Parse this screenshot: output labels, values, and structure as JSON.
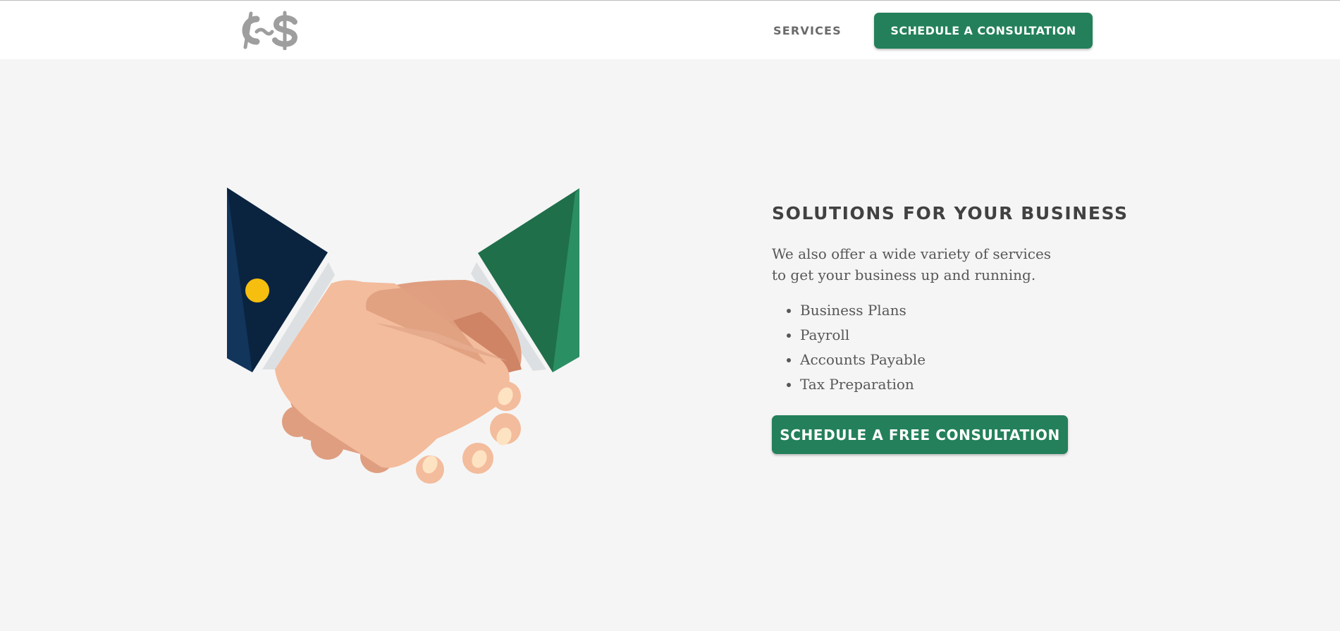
{
  "header": {
    "logo_text": "C$",
    "nav_services": "SERVICES",
    "nav_cta": "SCHEDULE A CONSULTATION"
  },
  "hero": {
    "illustration": "handshake-illustration",
    "heading": "SOLUTIONS FOR YOUR BUSINESS",
    "description": "We also offer a wide variety of services to get your business up and running.",
    "services": [
      "Business Plans",
      "Payroll",
      "Accounts Payable",
      "Tax Preparation"
    ],
    "cta": "SCHEDULE A FREE CONSULTATION"
  },
  "colors": {
    "brand_green": "#23805a",
    "background": "#f5f5f5",
    "header_bg": "#ffffff",
    "heading_text": "#414141",
    "body_text": "#575757",
    "logo_gray": "#9e9e9e"
  }
}
